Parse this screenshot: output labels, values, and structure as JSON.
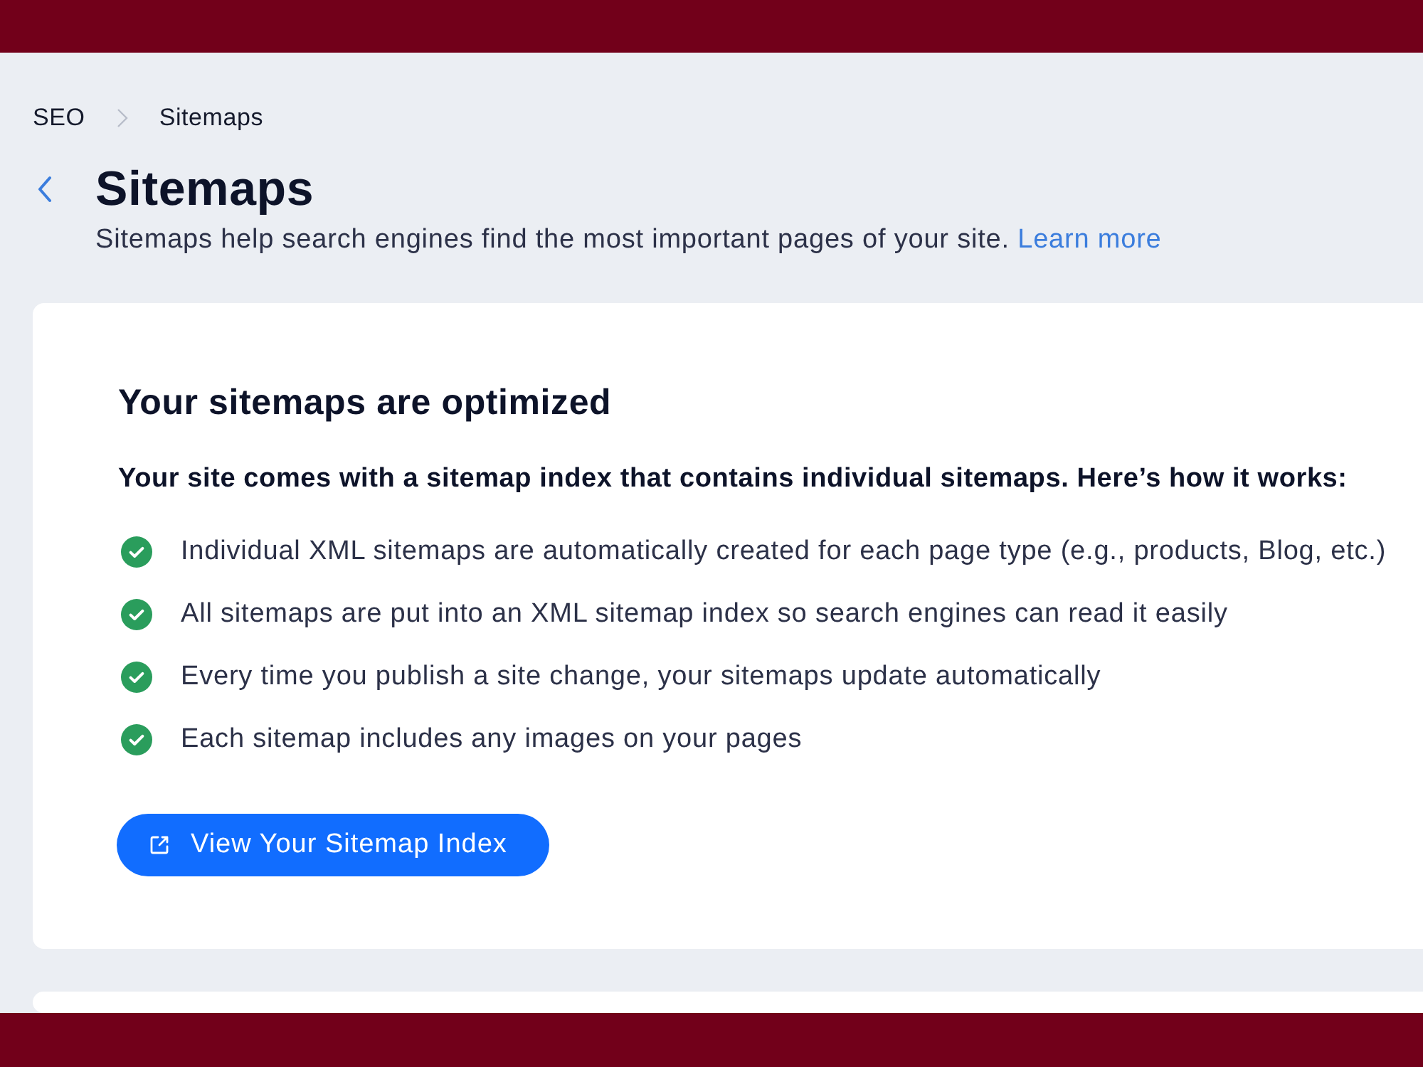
{
  "breadcrumb": [
    {
      "label": "SEO"
    },
    {
      "label": "Sitemaps"
    }
  ],
  "header": {
    "title": "Sitemaps",
    "description": "Sitemaps help search engines find the most important pages of your site.",
    "link": "Learn more"
  },
  "card": {
    "title": "Your sitemaps are optimized",
    "intro": "Your site comes with a sitemap index that contains individual sitemaps. Here’s how it works:",
    "items": [
      {
        "text": "Individual XML sitemaps are automatically created for each page type (e.g., products, Blog, etc.)",
        "checked": true
      },
      {
        "text": "All sitemaps are put into an XML sitemap index so search engines can read it easily",
        "checked": true
      },
      {
        "text": "Every time you publish a site change, your sitemaps update automatically",
        "checked": true
      },
      {
        "text": "Each sitemap includes any images on your pages",
        "checked": true
      }
    ],
    "button": "View Your Sitemap Index"
  }
}
